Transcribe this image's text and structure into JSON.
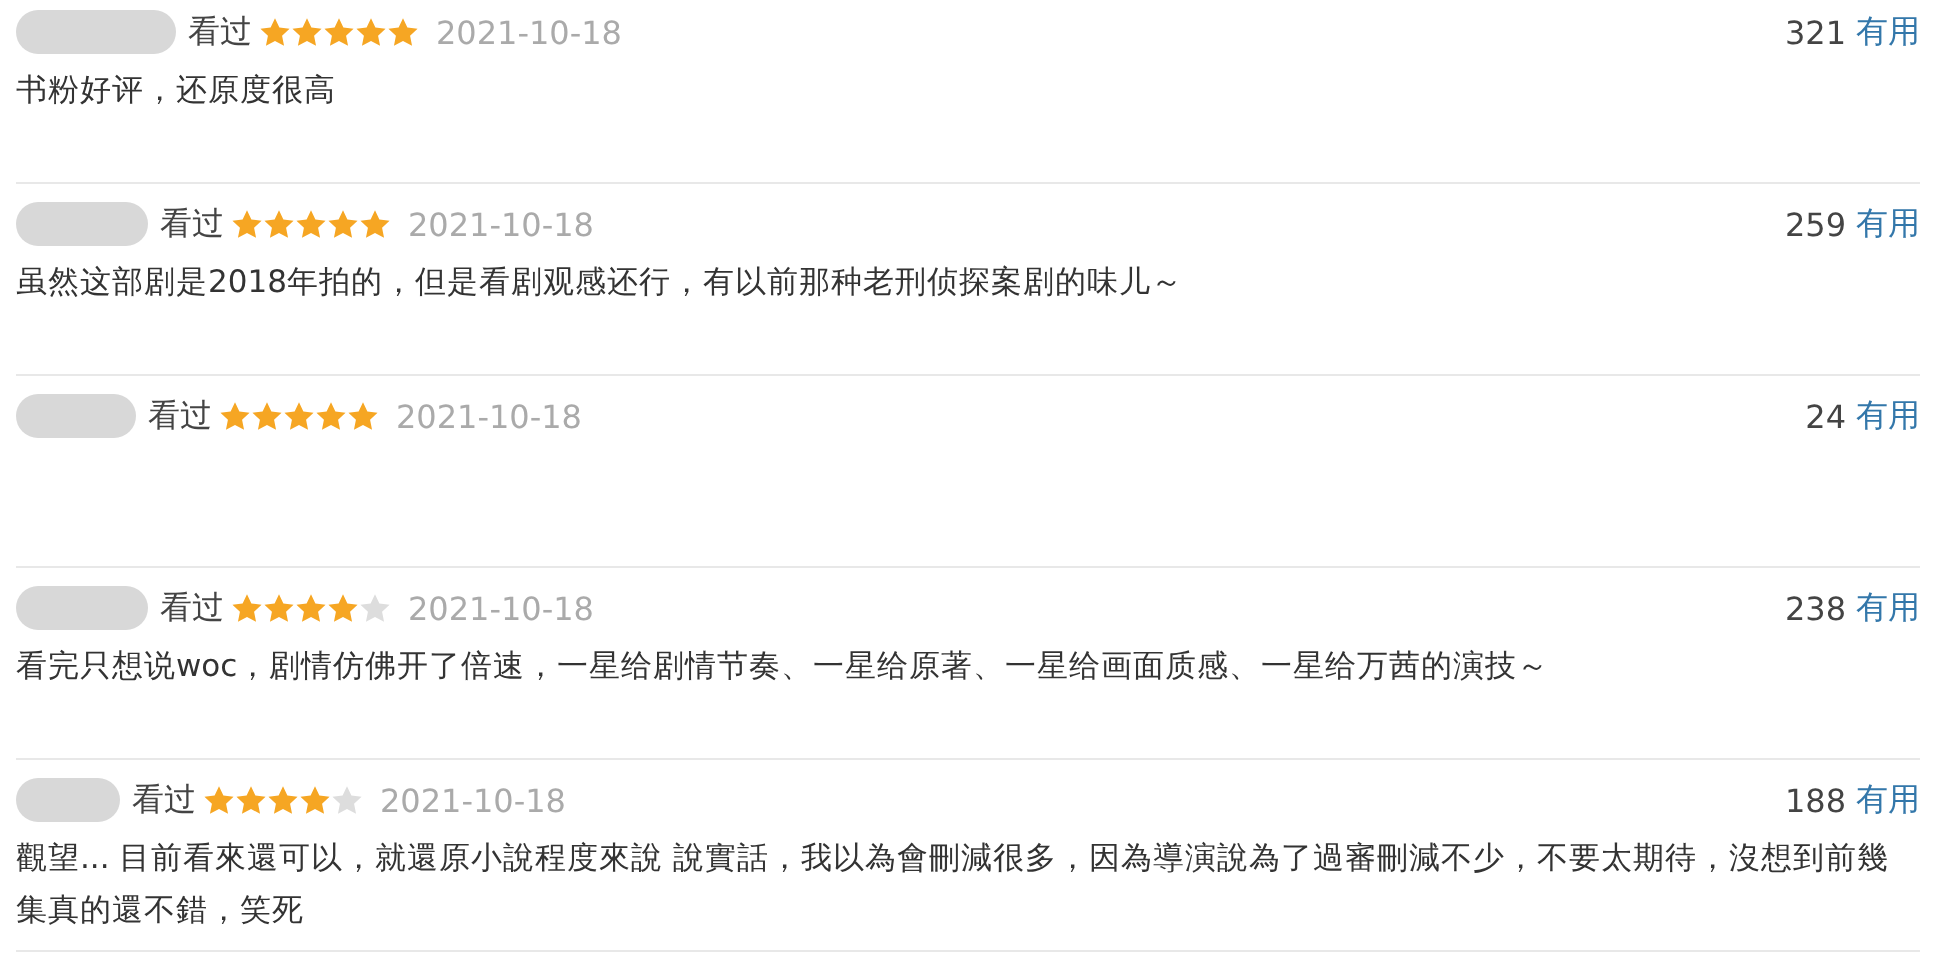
{
  "reviews": [
    {
      "status": "看过",
      "stars": 5,
      "date": "2021-10-18",
      "votes": "321",
      "useful": "有用",
      "comment": "书粉好评，还原度很高"
    },
    {
      "status": "看过",
      "stars": 5,
      "date": "2021-10-18",
      "votes": "259",
      "useful": "有用",
      "comment": "虽然这部剧是2018年拍的，但是看剧观感还行，有以前那种老刑侦探案剧的味儿～"
    },
    {
      "status": "看过",
      "stars": 5,
      "date": "2021-10-18",
      "votes": "24",
      "useful": "有用"
    },
    {
      "status": "看过",
      "stars": 4,
      "date": "2021-10-18",
      "votes": "238",
      "useful": "有用",
      "comment": "看完只想说woc，剧情仿佛开了倍速，一星给剧情节奏、一星给原著、一星给画面质感、一星给万茜的演技～"
    },
    {
      "status": "看过",
      "stars": 4,
      "date": "2021-10-18",
      "votes": "188",
      "useful": "有用",
      "comment": "觀望... 目前看來還可以，就還原小說程度來說 說實話，我以為會刪減很多，因為導演說為了過審刪減不少，不要太期待，沒想到前幾集真的還不錯，笑死"
    }
  ]
}
